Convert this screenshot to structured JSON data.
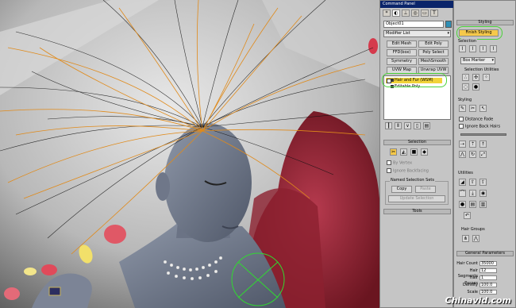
{
  "command_panel": {
    "title": "Command Panel",
    "tab_icons": [
      "create-icon",
      "modify-icon",
      "hierarchy-icon",
      "motion-icon",
      "display-icon",
      "utilities-icon"
    ],
    "tab_glyphs": [
      "*",
      "◐",
      "⊥",
      "◎",
      "▭",
      "T"
    ],
    "object_name": "Object01",
    "object_color": "#2f8fb5",
    "modifier_list": "Modifier List",
    "buttons": [
      [
        "Edit Mesh",
        "Edit Poly"
      ],
      [
        "FFD(box)",
        "Poly Select"
      ],
      [
        "Symmetry",
        "MeshSmooth"
      ],
      [
        "UVW Map",
        "Unwrap UVW"
      ]
    ],
    "stack": [
      {
        "label": "Hair and Fur (WSM)",
        "selected": true
      },
      {
        "label": "Editable Poly",
        "selected": false
      }
    ],
    "selection_rollout": "Selection",
    "by_vertex": "By Vertex",
    "ignore_backfacing": "Ignore Backfacing",
    "named_selection_sets": "Named Selection Sets",
    "copy": "Copy",
    "paste": "Paste",
    "update_selection": "Update Selection",
    "tools_rollout": "Tools"
  },
  "styling_panel": {
    "header": "Styling",
    "finish_styling": "Finish Styling",
    "selection_label": "Selection",
    "box_marker": "Box Marker",
    "selection_utilities": "Selection Utilities",
    "styling_label": "Styling",
    "distance_fade": "Distance Fade",
    "ignore_back_hairs": "Ignore Back Hairs",
    "utilities_label": "Utilities",
    "hair_groups_label": "Hair Groups",
    "general_parameters": "General Parameters",
    "params": [
      {
        "label": "Hair Count",
        "value": "35000"
      },
      {
        "label": "Hair Segments",
        "value": "12"
      },
      {
        "label": "Hair Passes",
        "value": "1"
      },
      {
        "label": "Density",
        "value": "100.0"
      },
      {
        "label": "Scale",
        "value": "100.0"
      }
    ]
  },
  "colors": {
    "accent_highlight": "#4bd33a",
    "selected_item": "#f2d33a",
    "title_bar": "#0a246a",
    "finish_button": "#f6c94a"
  },
  "watermark": "Chinavid.com"
}
